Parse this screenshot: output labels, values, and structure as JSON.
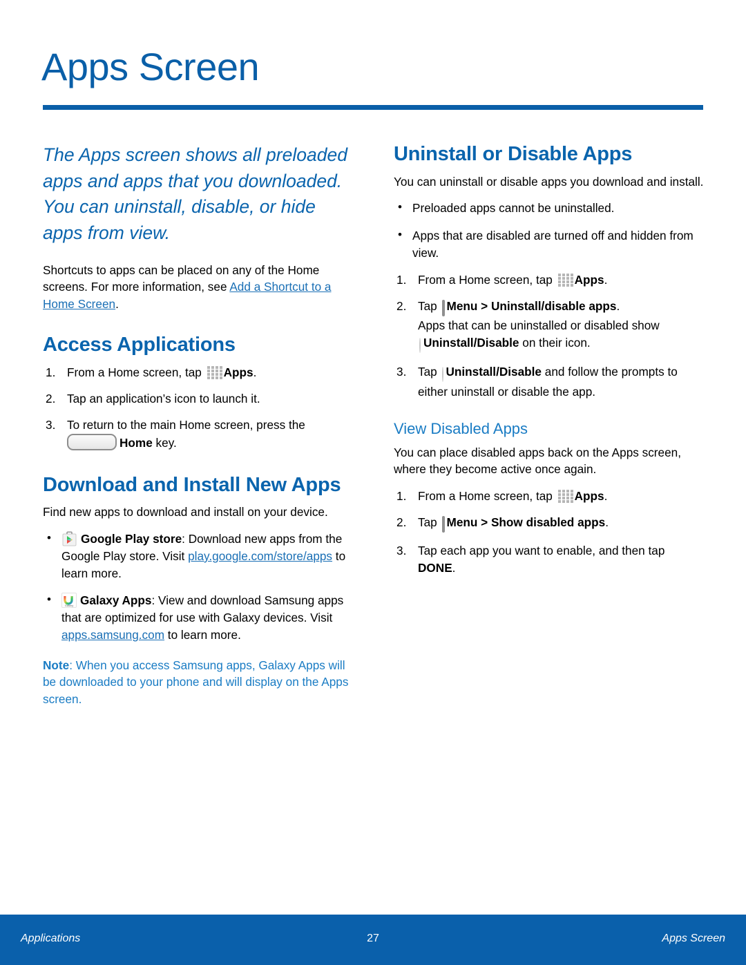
{
  "page": {
    "title": "Apps Screen",
    "accent_color": "#0a5fa8",
    "link_color": "#1a6fb5",
    "note_color": "#1a7cc4"
  },
  "left_column": {
    "lede": "The Apps screen shows all preloaded apps and apps that you downloaded. You can uninstall, disable, or hide apps from view.",
    "intro_text_before_link": "Shortcuts to apps can be placed on any of the Home screens. For more information, see ",
    "intro_link": "Add a Shortcut to a Home Screen",
    "intro_text_after_link": ".",
    "access": {
      "heading": "Access Applications",
      "step1_before_icon": "From a Home screen, tap ",
      "step1_icon": "apps-grid-icon",
      "step1_bold": "Apps",
      "step1_after": ".",
      "step2": "Tap an application’s icon to launch it.",
      "step3_line1": "To return to the main Home screen, press the",
      "step3_icon": "home-key-icon",
      "step3_bold": "Home",
      "step3_after": " key."
    },
    "download": {
      "heading": "Download and Install New Apps",
      "intro": "Find new apps to download and install on your device.",
      "bullet1_icon": "google-play-store-icon",
      "bullet1_bold": "Google Play store",
      "bullet1_text_before_link": ": Download new apps from the Google Play store. Visit ",
      "bullet1_link": "play.google.com/store/apps",
      "bullet1_text_after_link": " to learn more.",
      "bullet2_icon": "galaxy-apps-icon",
      "bullet2_bold": "Galaxy Apps",
      "bullet2_text_before_link": ": View and download Samsung apps that are optimized for use with Galaxy devices. Visit ",
      "bullet2_link": "apps.samsung.com",
      "bullet2_text_after_link": " to learn more."
    },
    "note": {
      "label": "Note",
      "text": ": When you access Samsung apps, Galaxy Apps will be downloaded to your phone and will display on the Apps screen."
    }
  },
  "right_column": {
    "uninstall": {
      "heading": "Uninstall or Disable Apps",
      "intro": "You can uninstall or disable apps you download and install.",
      "bullet1": "Preloaded apps cannot be uninstalled.",
      "bullet2": "Apps that are disabled are turned off and hidden from view.",
      "step1_before_icon": "From a Home screen, tap ",
      "step1_icon": "apps-grid-icon",
      "step1_bold": "Apps",
      "step1_after": ".",
      "step2_before_icon": "Tap ",
      "step2_icon": "menu-icon",
      "step2_bold": "Menu > Uninstall/disable apps",
      "step2_after": ".",
      "step2_line2": "Apps that can be uninstalled or disabled show ",
      "step2_icon2": "uninstall-disable-icon",
      "step2_bold2": "Uninstall/Disable",
      "step2_line2_after": " on their icon.",
      "step3_before_icon": "Tap ",
      "step3_icon": "uninstall-disable-icon",
      "step3_bold": "Uninstall/Disable",
      "step3_after": " and follow the prompts to either uninstall  or disable the app."
    },
    "view_disabled": {
      "heading": "View Disabled Apps",
      "intro": "You can place disabled apps back on the Apps screen, where they become active once again.",
      "step1_before_icon": "From a Home screen, tap ",
      "step1_icon": "apps-grid-icon",
      "step1_bold": "Apps",
      "step1_after": ".",
      "step2_before_icon": "Tap ",
      "step2_icon": "menu-icon",
      "step2_bold": "Menu > Show disabled apps",
      "step2_after": ".",
      "step3_text": "Tap each app you want to enable, and then tap ",
      "step3_bold": "DONE",
      "step3_after": "."
    }
  },
  "footer": {
    "left": "Applications",
    "center": "27",
    "right": "Apps Screen"
  }
}
